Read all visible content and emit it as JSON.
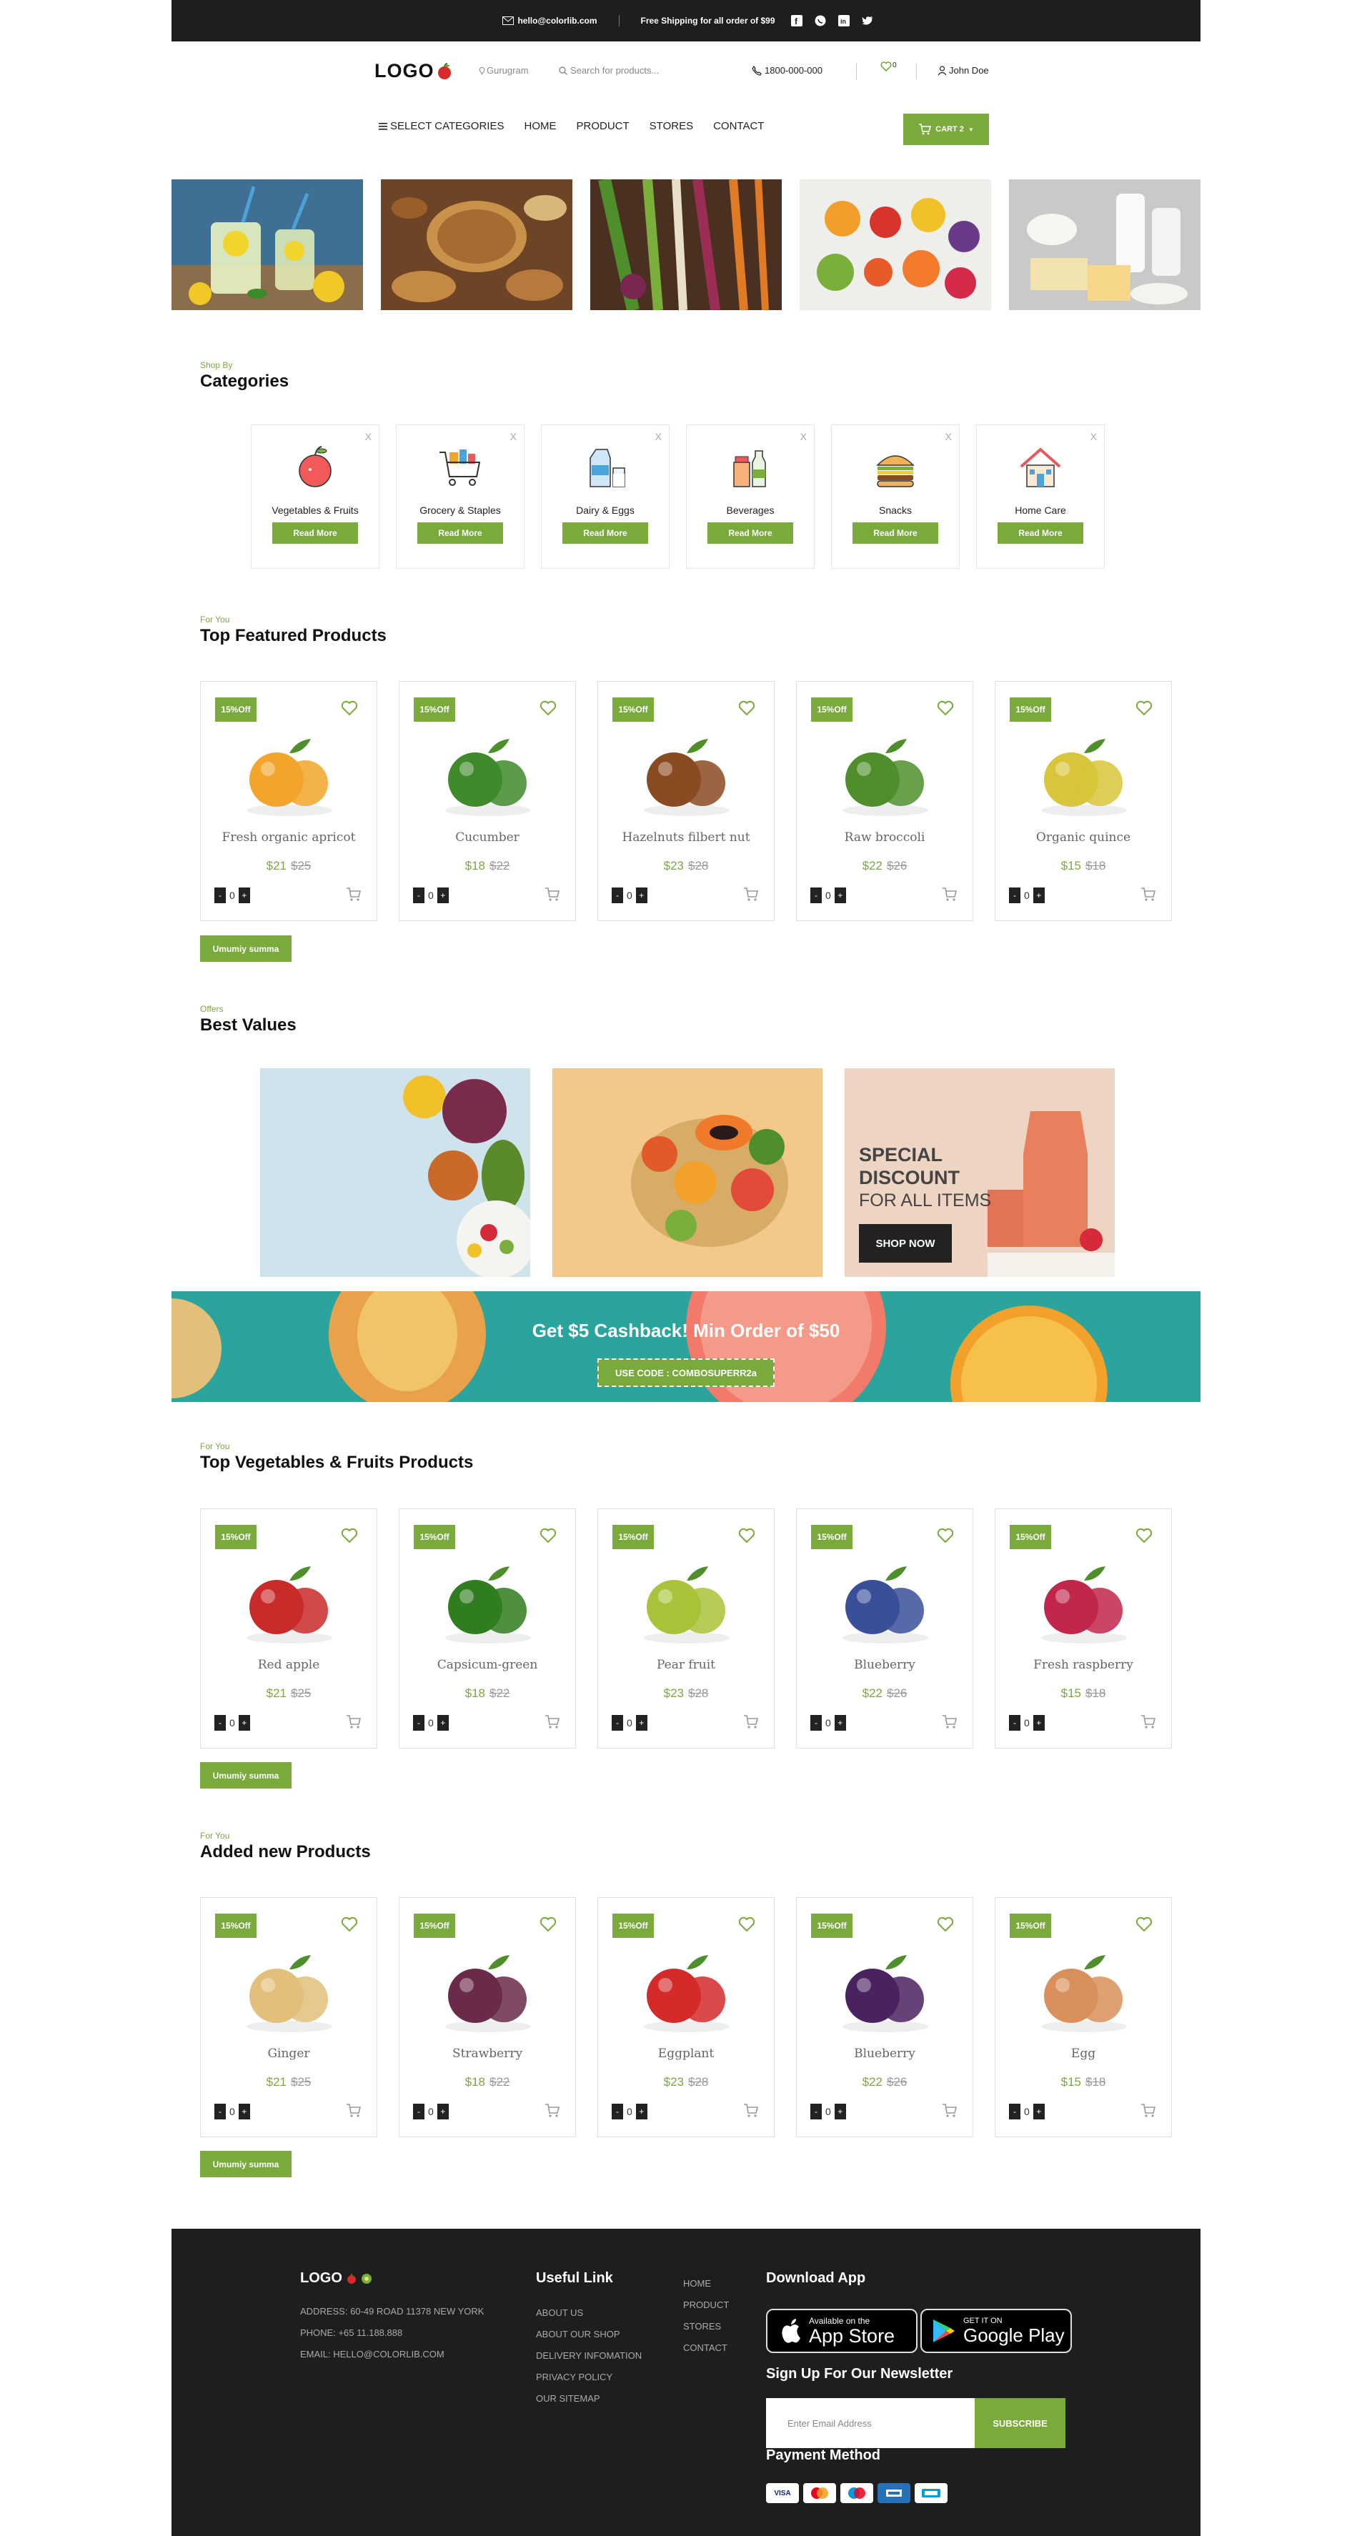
{
  "topbar": {
    "email": "hello@colorlib.com",
    "shipping": "Free Shipping for all order of $99",
    "social_icons": [
      "facebook-icon",
      "whatsapp-icon",
      "linkedin-icon",
      "twitter-icon"
    ]
  },
  "header": {
    "logo": "LOGO",
    "location": "Gurugram",
    "search_placeholder": "Search for products...",
    "phone": "1800-000-000",
    "wishlist_count": "0",
    "user": "John Doe"
  },
  "nav": {
    "categories": "SELECT CATEGORIES",
    "items": [
      "HOME",
      "PRODUCT",
      "STORES",
      "CONTACT"
    ],
    "cart": "CART 2"
  },
  "categories": {
    "eyebrow": "Shop By",
    "title": "Categories",
    "close": "X",
    "read_more": "Read More",
    "items": [
      {
        "name": "Vegetables & Fruits",
        "icon": "apple-icon"
      },
      {
        "name": "Grocery & Staples",
        "icon": "shopping-cart-icon"
      },
      {
        "name": "Dairy & Eggs",
        "icon": "milk-icon"
      },
      {
        "name": "Beverages",
        "icon": "beverage-icon"
      },
      {
        "name": "Snacks",
        "icon": "burger-icon"
      },
      {
        "name": "Home Care",
        "icon": "house-icon"
      }
    ]
  },
  "featured": {
    "eyebrow": "For You",
    "title": "Top Featured Products",
    "button": "Umumiy summa",
    "products": [
      {
        "badge": "15%Off",
        "name": "Fresh organic apricot",
        "price": "$21",
        "old": "$25",
        "qty": "0",
        "color": "#f2a42b"
      },
      {
        "badge": "15%Off",
        "name": "Cucumber",
        "price": "$18",
        "old": "$22",
        "qty": "0",
        "color": "#3f8a2a"
      },
      {
        "badge": "15%Off",
        "name": "Hazelnuts filbert nut",
        "price": "$23",
        "old": "$28",
        "qty": "0",
        "color": "#8a4a22"
      },
      {
        "badge": "15%Off",
        "name": "Raw broccoli",
        "price": "$22",
        "old": "$26",
        "qty": "0",
        "color": "#4f8f2b"
      },
      {
        "badge": "15%Off",
        "name": "Organic quince",
        "price": "$15",
        "old": "$18",
        "qty": "0",
        "color": "#d8c53a"
      }
    ]
  },
  "best_values": {
    "eyebrow": "Offers",
    "title": "Best Values",
    "special_line1": "SPECIAL",
    "special_line2": "DISCOUNT",
    "special_line3": "FOR ALL ITEMS",
    "shop_now": "SHOP NOW"
  },
  "cashback": {
    "headline": "Get $5 Cashback! Min Order of $50",
    "code": "USE CODE : COMBOSUPERR2a"
  },
  "veg": {
    "eyebrow": "For You",
    "title": "Top Vegetables & Fruits Products",
    "button": "Umumiy summa",
    "products": [
      {
        "badge": "15%Off",
        "name": "Red apple",
        "price": "$21",
        "old": "$25",
        "qty": "0",
        "color": "#c92a2a"
      },
      {
        "badge": "15%Off",
        "name": "Capsicum-green",
        "price": "$18",
        "old": "$22",
        "qty": "0",
        "color": "#2f7d1f"
      },
      {
        "badge": "15%Off",
        "name": "Pear fruit",
        "price": "$23",
        "old": "$28",
        "qty": "0",
        "color": "#a9c33a"
      },
      {
        "badge": "15%Off",
        "name": "Blueberry",
        "price": "$22",
        "old": "$26",
        "qty": "0",
        "color": "#3a4f9a"
      },
      {
        "badge": "15%Off",
        "name": "Fresh raspberry",
        "price": "$15",
        "old": "$18",
        "qty": "0",
        "color": "#c2264a"
      }
    ]
  },
  "added": {
    "eyebrow": "For You",
    "title": "Added new Products",
    "button": "Umumiy summa",
    "products": [
      {
        "badge": "15%Off",
        "name": "Ginger",
        "price": "$21",
        "old": "$25",
        "qty": "0",
        "color": "#e2c07a"
      },
      {
        "badge": "15%Off",
        "name": "Strawberry",
        "price": "$18",
        "old": "$22",
        "qty": "0",
        "color": "#6a2a4a"
      },
      {
        "badge": "15%Off",
        "name": "Eggplant",
        "price": "$23",
        "old": "$28",
        "qty": "0",
        "color": "#d42a2a"
      },
      {
        "badge": "15%Off",
        "name": "Blueberry",
        "price": "$22",
        "old": "$26",
        "qty": "0",
        "color": "#4a2260"
      },
      {
        "badge": "15%Off",
        "name": "Egg",
        "price": "$15",
        "old": "$18",
        "qty": "0",
        "color": "#d9905a"
      }
    ]
  },
  "footer": {
    "logo": "LOGO",
    "address": "ADDRESS: 60-49 ROAD 11378 NEW YORK",
    "phone": "PHONE: +65 11.188.888",
    "email": "EMAIL: HELLO@COLORLIB.COM",
    "useful_title": "Useful Link",
    "useful_links": [
      "ABOUT US",
      "ABOUT OUR SHOP",
      "DELIVERY INFOMATION",
      "PRIVACY POLICY",
      "OUR SITEMAP"
    ],
    "links2": [
      "HOME",
      "PRODUCT",
      "STORES",
      "CONTACT"
    ],
    "download_title": "Download App",
    "appstore_small": "Available on the",
    "appstore_big": "App Store",
    "googleplay_small": "GET IT ON",
    "googleplay_big": "Google Play",
    "newsletter_title": "Sign Up For Our Newsletter",
    "email_placeholder": "Enter Email Address",
    "subscribe": "SUBSCRIBE",
    "payment_title": "Payment Method",
    "payments": [
      "VISA",
      "mastercard",
      "maestro",
      "amex",
      "paypal"
    ]
  },
  "colors": {
    "accent": "#7aa93c",
    "dark": "#1e1e1e",
    "teal": "#2aa49c"
  }
}
